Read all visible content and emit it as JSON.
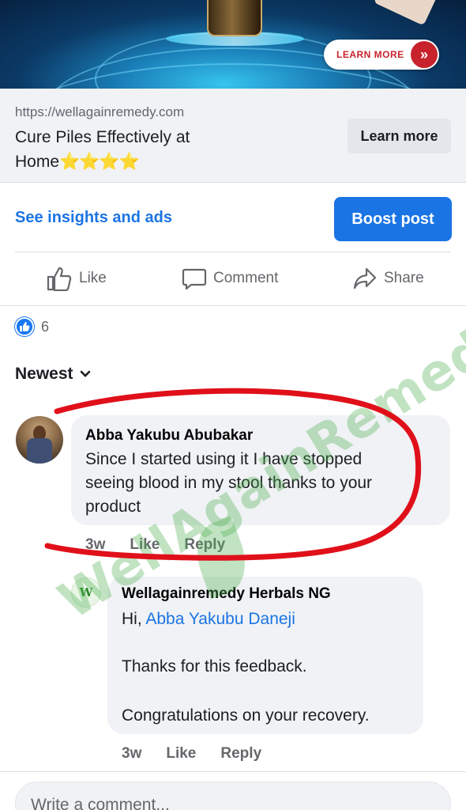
{
  "banner": {
    "cta": "LEARN MORE",
    "cta_icon": "double-chevron-right-icon"
  },
  "link_preview": {
    "url": "https://wellagainremedy.com",
    "title": "Cure Piles Effectively at Home",
    "stars": "⭐⭐⭐⭐",
    "button": "Learn more"
  },
  "insights": {
    "link": "See insights and ads",
    "boost": "Boost post"
  },
  "actions": {
    "like": "Like",
    "comment": "Comment",
    "share": "Share"
  },
  "reactions": {
    "count": "6",
    "icon": "like-reaction-icon"
  },
  "sort": {
    "label": "Newest",
    "icon": "chevron-down-icon"
  },
  "comments": [
    {
      "author": "Abba Yakubu Abubakar",
      "lines": [
        "Since I started using it I have stopped",
        "seeing blood in my stool thanks to your",
        "product"
      ],
      "time": "3w",
      "like": "Like",
      "reply": "Reply"
    },
    {
      "author": "Wellagainremedy Herbals NG",
      "greeting": "Hi,",
      "mention": "Abba Yakubu Daneji",
      "line1": "Thanks for this feedback.",
      "line2": "Congratulations on your recovery.",
      "avatar_text": "W",
      "time": "3w",
      "like": "Like",
      "reply": "Reply"
    }
  ],
  "composer": {
    "placeholder": "Write a comment..."
  },
  "watermark": "WellAgainRemedy",
  "colors": {
    "facebook_blue": "#1b74e4",
    "annotation_red": "#e0101a",
    "watermark_green": "#4caf50"
  }
}
